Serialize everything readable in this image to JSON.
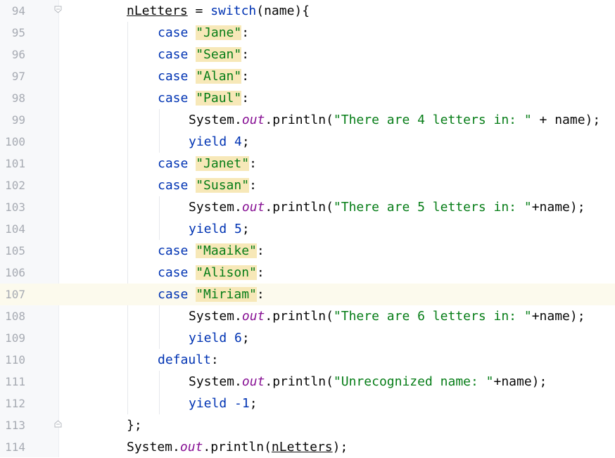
{
  "editor": {
    "lines": [
      {
        "n": "94"
      },
      {
        "n": "95"
      },
      {
        "n": "96"
      },
      {
        "n": "97"
      },
      {
        "n": "98"
      },
      {
        "n": "99"
      },
      {
        "n": "100"
      },
      {
        "n": "101"
      },
      {
        "n": "102"
      },
      {
        "n": "103"
      },
      {
        "n": "104"
      },
      {
        "n": "105"
      },
      {
        "n": "106"
      },
      {
        "n": "107"
      },
      {
        "n": "108"
      },
      {
        "n": "109"
      },
      {
        "n": "110"
      },
      {
        "n": "111"
      },
      {
        "n": "112"
      },
      {
        "n": "113"
      },
      {
        "n": "114"
      }
    ],
    "tokens": {
      "nLetters": "nLetters",
      "assign_switch_open": " = ",
      "switch_kw": "switch",
      "switch_arg": "(name){",
      "case": "case",
      "colon": ":",
      "jane": "\"Jane\"",
      "sean": "\"Sean\"",
      "alan": "\"Alan\"",
      "paul": "\"Paul\"",
      "janet": "\"Janet\"",
      "susan": "\"Susan\"",
      "maaike": "\"Maaike\"",
      "alison": "\"Alison\"",
      "miriam": "\"Miriam\"",
      "system": "System.",
      "out": "out",
      "println_open": ".println(",
      "str4": "\"There are 4 letters in: \"",
      "plus_name_close": " + name);",
      "str5": "\"There are 5 letters in: \"",
      "str6": "\"There are 6 letters in: \"",
      "plusname_close": "+name);",
      "yield": "yield",
      "v4": " 4",
      "v5": " 5",
      "v6": " 6",
      "vneg1": " -1",
      "semi": ";",
      "default": "default",
      "unrec": "\"Unrecognized name: \"",
      "close_switch": "};",
      "println_nletters_open": ".println(",
      "println_nletters_close": ");"
    },
    "current_line": "107"
  },
  "colors": {
    "keyword": "#0033b3",
    "string": "#067d17",
    "string_highlight": "#f7e8b8",
    "static_field": "#871094",
    "line_number": "#a7abb3",
    "current_line_bg": "#fcfaed"
  }
}
